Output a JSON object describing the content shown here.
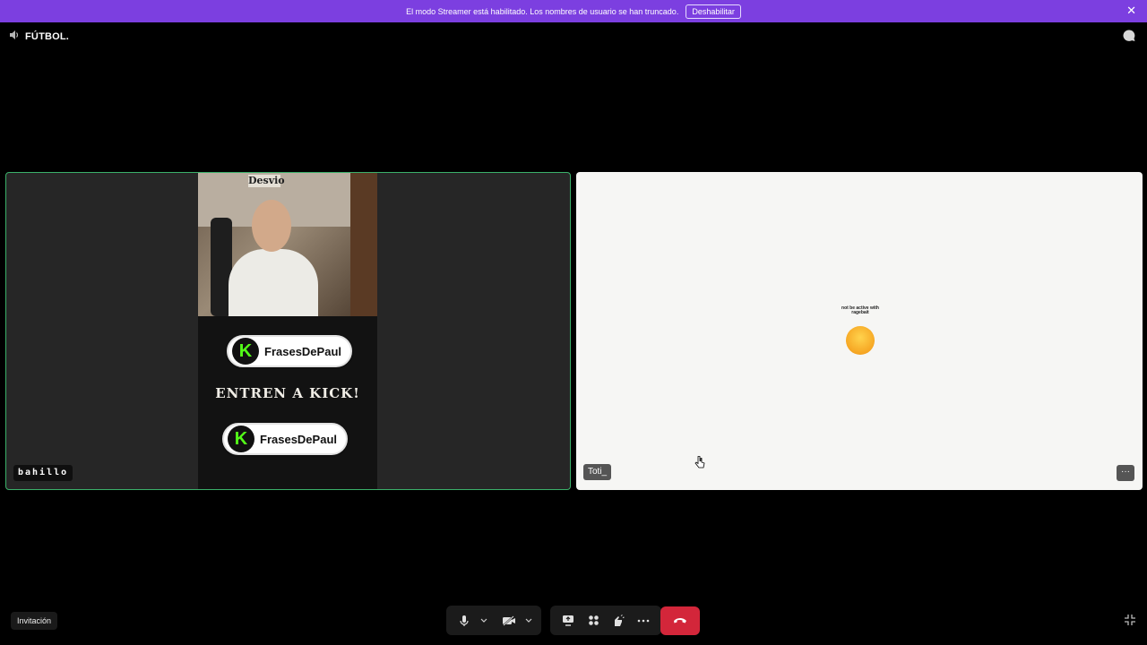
{
  "banner": {
    "message": "El modo Streamer está habilitado. Los nombres de usuario se han truncado.",
    "button_label": "Deshabilitar",
    "close_glyph": "✕",
    "color": "#7c3fe0"
  },
  "header": {
    "channel_name": "FÚTBOL.",
    "channel_icon": "speaker-icon",
    "chat_icon": "chat-bubble-icon"
  },
  "tiles": [
    {
      "username": "bahillo",
      "speaking": true,
      "border_color": "#3bb06a",
      "stream": {
        "sign_text": "Desvio",
        "promo_label_1": "FrasesDePaul",
        "promo_label_2": "FrasesDePaul",
        "kick_glyph": "K",
        "headline": "ENTREN A KICK!"
      }
    },
    {
      "username": "Toti_",
      "speaking": false,
      "more_glyph": "···",
      "emoji_caption": "not be active with ragebait"
    }
  ],
  "bottom": {
    "invite_label": "Invitación",
    "controls": [
      "microphone-icon",
      "chevron-down-icon",
      "camera-off-icon",
      "chevron-down-icon",
      "screen-share-icon",
      "activities-icon",
      "soundboard-icon",
      "more-icon"
    ],
    "end_call_icon": "hang-up-icon",
    "end_call_color": "#d3263a",
    "fullscreen_icon": "exit-fullscreen-icon"
  }
}
